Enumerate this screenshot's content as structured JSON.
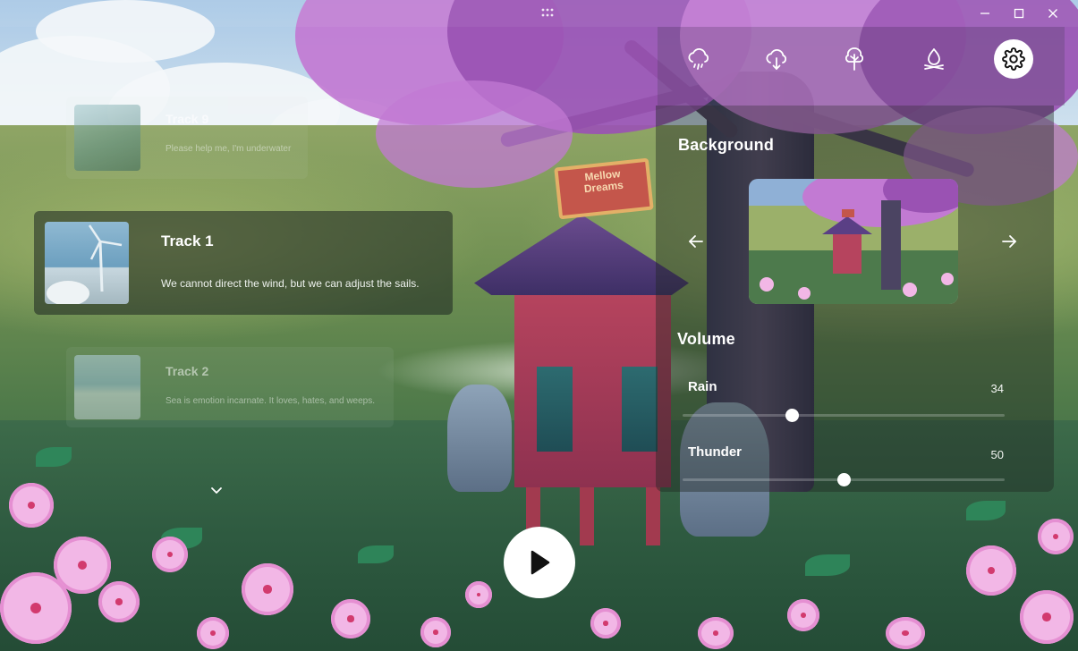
{
  "tracks": {
    "previous": {
      "title": "Track 9",
      "subtitle": "Please help me, I'm underwater"
    },
    "current": {
      "title": "Track 1",
      "subtitle": "We cannot direct the wind, but we can adjust the sails."
    },
    "next": {
      "title": "Track 2",
      "subtitle": "Sea is emotion incarnate. It loves, hates, and weeps."
    }
  },
  "toolbar": {
    "icons": [
      "cloud-rain-icon",
      "cloud-download-icon",
      "tree-icon",
      "campfire-icon",
      "gear-icon"
    ],
    "active": "gear-icon"
  },
  "settings": {
    "background": {
      "heading": "Background",
      "sign_text": "Mellow Dreams"
    },
    "volume": {
      "heading": "Volume",
      "channels": [
        {
          "label": "Rain",
          "value": 34
        },
        {
          "label": "Thunder",
          "value": 50
        }
      ]
    }
  },
  "colors": {
    "accent": "#ffffff",
    "panel": "#1e2622",
    "blossom": "#c27ad3",
    "shrine": "#b6445e"
  }
}
